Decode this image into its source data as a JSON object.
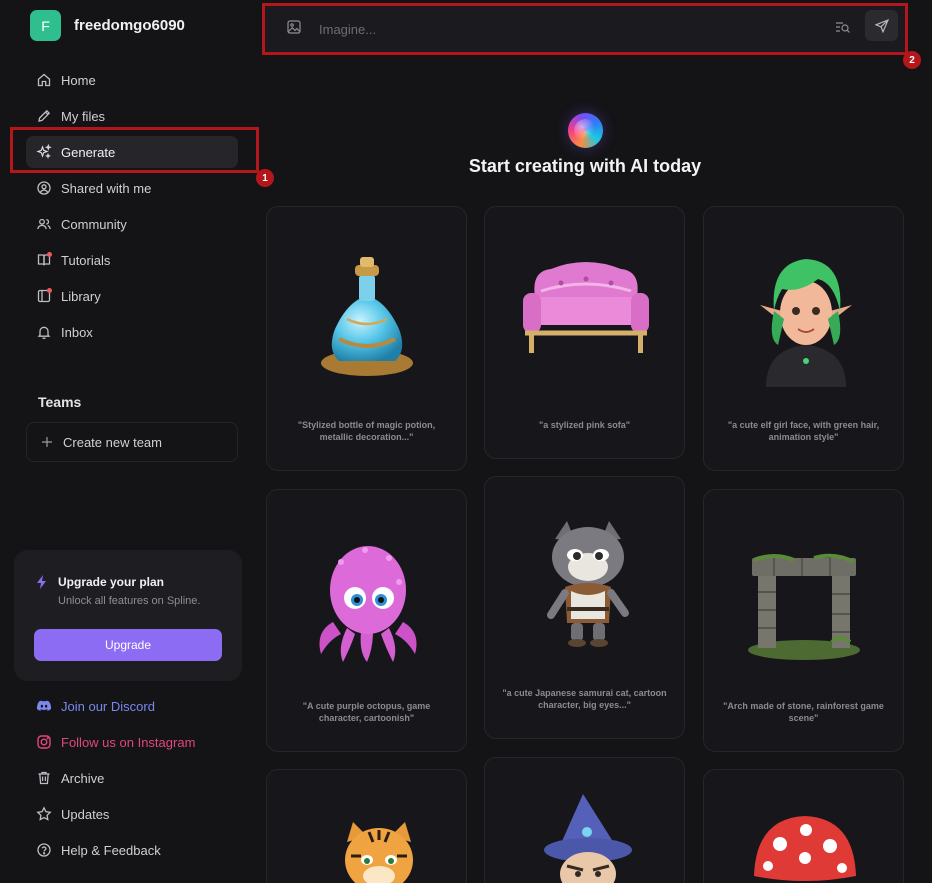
{
  "user": {
    "initial": "F",
    "name": "freedomgo6090"
  },
  "nav": [
    {
      "label": "Home",
      "icon": "home-icon"
    },
    {
      "label": "My files",
      "icon": "pencil-icon"
    },
    {
      "label": "Generate",
      "icon": "sparkles-icon",
      "active": true
    },
    {
      "label": "Shared with me",
      "icon": "user-circle-icon"
    },
    {
      "label": "Community",
      "icon": "users-icon"
    },
    {
      "label": "Tutorials",
      "icon": "book-icon"
    },
    {
      "label": "Library",
      "icon": "library-icon"
    },
    {
      "label": "Inbox",
      "icon": "bell-icon"
    }
  ],
  "teams": {
    "title": "Teams",
    "create_label": "Create new team"
  },
  "upgrade": {
    "title": "Upgrade your plan",
    "subtitle": "Unlock all features on Spline.",
    "button": "Upgrade"
  },
  "footer": [
    {
      "label": "Join our Discord",
      "icon": "discord-icon"
    },
    {
      "label": "Follow us on Instagram",
      "icon": "instagram-icon"
    },
    {
      "label": "Archive",
      "icon": "trash-icon"
    },
    {
      "label": "Updates",
      "icon": "star-icon"
    },
    {
      "label": "Help & Feedback",
      "icon": "help-icon"
    }
  ],
  "search": {
    "placeholder": "Imagine..."
  },
  "annotations": [
    "1",
    "2"
  ],
  "headline": "Start creating with AI today",
  "cards": [
    {
      "caption": "\"Stylized bottle of magic potion, metallic decoration...\""
    },
    {
      "caption": "\"a stylized pink sofa\""
    },
    {
      "caption": "\"a cute elf girl face, with green hair, animation style\""
    },
    {
      "caption": "\"A cute purple octopus, game character, cartoonish\""
    },
    {
      "caption": "\"a cute Japanese samurai cat, cartoon character, big eyes...\""
    },
    {
      "caption": "\"Arch made of stone, rainforest game scene\""
    },
    {
      "caption": ""
    },
    {
      "caption": ""
    },
    {
      "caption": ""
    }
  ],
  "colors": {
    "accent": "#8c6cf3",
    "highlight": "#b3161b",
    "background": "#141417"
  }
}
